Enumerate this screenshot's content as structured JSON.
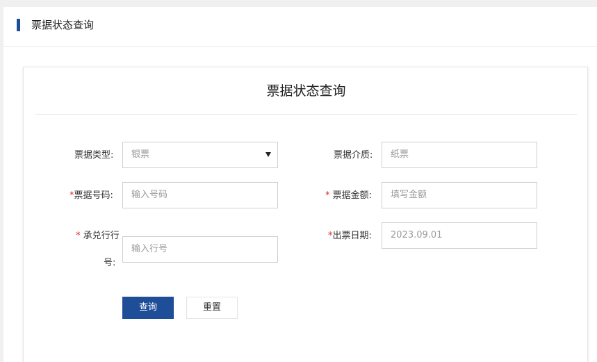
{
  "header": {
    "title": "票据状态查询"
  },
  "form": {
    "title": "票据状态查询",
    "bill_type": {
      "label": "票据类型:",
      "value": "银票"
    },
    "bill_medium": {
      "label": "票据介质:",
      "value": "纸票"
    },
    "bill_number": {
      "required_mark": "*",
      "label": "票据号码:",
      "placeholder": "输入号码"
    },
    "bill_amount": {
      "required_mark": "*",
      "label": " 票据金额:",
      "placeholder": "填写金额"
    },
    "acceptor_bank": {
      "required_mark": "*",
      "label_line1": " 承兑行行",
      "label_line2": "号:",
      "placeholder": "输入行号"
    },
    "issue_date": {
      "required_mark": "*",
      "label": "出票日期:",
      "value": "2023.09.01"
    },
    "buttons": {
      "query": "查询",
      "reset": "重置"
    }
  },
  "colors": {
    "primary": "#1f4e99",
    "required": "#e02b2b"
  }
}
